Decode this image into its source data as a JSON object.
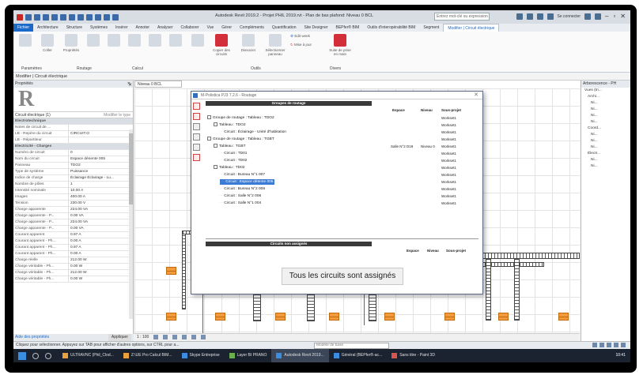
{
  "titlebar": {
    "title": "Autodesk Revit 2019.2 - Projet PHIL 2019.rvt - Plan de bas plafond: Niveau 0 BCL",
    "search_placeholder": "Entrez mot-clé ou expression",
    "signin": "Se connecter"
  },
  "tabs": [
    "Fichier",
    "Architecture",
    "Structure",
    "Systèmes",
    "Insérer",
    "Annoter",
    "Analyser",
    "Collaborer",
    "Vue",
    "Gérer",
    "Compléments",
    "Quantification",
    "Site Designer",
    "BEPfer® BIM",
    "Outils d'interopérabilité BIM",
    "Segment",
    "Modifier | Circuit électrique"
  ],
  "ribbon": {
    "buttons": [
      "Coller",
      "Propriétés",
      "Copier des circuits",
      "Dissocier",
      "Sélectionner panneau",
      "Suite de prise en main"
    ],
    "panels": [
      "Paramètres",
      "Routage",
      "Calcul",
      "Outils",
      "Divers"
    ],
    "options": [
      "Edit week",
      "Mise à jour"
    ]
  },
  "context": "Modifier | Circuit électrique",
  "properties": {
    "header": "Propriétés",
    "logo": "R",
    "type": "Circuit électrique (1)",
    "edit_type": "Modifier le type",
    "rows": [
      {
        "k": "Electrotechnique",
        "v": "",
        "grp": true
      },
      {
        "k": "Notes de circuit de ...",
        "v": ""
      },
      {
        "k": "LB - Repère du circuit",
        "v": "CIRCUIT.O"
      },
      {
        "k": "LB - Répartiteur",
        "v": ""
      },
      {
        "k": "Electricité - Charges",
        "v": "",
        "grp": true
      },
      {
        "k": "Numéro de circuit",
        "v": "0"
      },
      {
        "k": "Nom du circuit",
        "v": "Espace dénente 005"
      },
      {
        "k": "Panneau",
        "v": "TDO2"
      },
      {
        "k": "Type de système",
        "v": "Puissance"
      },
      {
        "k": "Indice de charge",
        "v": "Éclairage Éclairage - Lu..."
      },
      {
        "k": "Nombre de pôles",
        "v": "1"
      },
      {
        "k": "Intensité nominale",
        "v": "10.00 A"
      },
      {
        "k": "Images",
        "v": "400.00 A"
      },
      {
        "k": "Tension",
        "v": "230.00 V"
      },
      {
        "k": "Charge apparente",
        "v": "224.00 VA"
      },
      {
        "k": "Charge apparente - P...",
        "v": "0.00 VA"
      },
      {
        "k": "Charge apparente - P...",
        "v": "224.00 VA"
      },
      {
        "k": "Charge apparente - P...",
        "v": "0.00 VA"
      },
      {
        "k": "Courant apparent",
        "v": "0.97 A"
      },
      {
        "k": "Courant apparent - Ph...",
        "v": "0.00 A"
      },
      {
        "k": "Courant apparent - Ph...",
        "v": "0.97 A"
      },
      {
        "k": "Courant apparent - Ph...",
        "v": "0.00 A"
      },
      {
        "k": "Charge réelle",
        "v": "212.00 W"
      },
      {
        "k": "Charge véritable - Ph...",
        "v": "0.00 W"
      },
      {
        "k": "Charge véritable - Ph...",
        "v": "212.00 W"
      },
      {
        "k": "Charge véritable - Ph...",
        "v": "0.00 W"
      }
    ],
    "help": "Aide des propriétés",
    "apply": "Appliquer"
  },
  "view": {
    "tab": "Niveau 0 BCL",
    "scale": "1 : 100"
  },
  "browser": {
    "header": "Arborescence - PH",
    "items": [
      "Vues (tri...",
      "Archi...",
      "Ni...",
      "Ni...",
      "Ni...",
      "Ni...",
      "Coord...",
      "Ni...",
      "Ni...",
      "Ni...",
      "Électr...",
      "Ni...",
      "Ni..."
    ]
  },
  "dialog": {
    "title": "M-Polistica PJ3 7.2.6 - Routage",
    "groups_header": "Groupes de routage",
    "col_space": "Espace",
    "col_level": "Niveau",
    "col_subproject": "Sous-projet",
    "rows": [
      {
        "label": "Groupe de routage : Tableau : TDO2",
        "indent": 0,
        "check": true,
        "space": "",
        "level": "",
        "sub": "Workset1"
      },
      {
        "label": "Tableau : TDO2",
        "indent": 1,
        "check": true,
        "space": "",
        "level": "",
        "sub": "Workset1"
      },
      {
        "label": "Circuit : Éclairage - Unité d'habitation",
        "indent": 2,
        "check": false,
        "space": "",
        "level": "",
        "sub": "Workset1"
      },
      {
        "label": "Groupe de routage : Tableau : TGBT",
        "indent": 0,
        "check": true,
        "space": "",
        "level": "",
        "sub": "Workset1"
      },
      {
        "label": "Tableau : TGBT",
        "indent": 1,
        "check": true,
        "space": "Salle N°2 D19",
        "level": "Niveau 0",
        "sub": "Workset1"
      },
      {
        "label": "Circuit : TD01",
        "indent": 2,
        "check": false,
        "space": "",
        "level": "",
        "sub": "Workset1"
      },
      {
        "label": "Circuit : TD02",
        "indent": 2,
        "check": false,
        "space": "",
        "level": "",
        "sub": "Workset1"
      },
      {
        "label": "Tableau : TD02",
        "indent": 1,
        "check": true,
        "space": "",
        "level": "",
        "sub": "Workset1"
      },
      {
        "label": "Circuit : Bureau N°1 007",
        "indent": 2,
        "check": false,
        "space": "",
        "level": "",
        "sub": "Workset1"
      },
      {
        "label": "Circuit : Espace détente 005",
        "indent": 2,
        "check": false,
        "space": "",
        "level": "",
        "sub": "Workset1",
        "selected": true
      },
      {
        "label": "Circuit : Bureau N°2 008",
        "indent": 2,
        "check": false,
        "space": "",
        "level": "",
        "sub": "Workset1"
      },
      {
        "label": "Circuit : Salle N°2 006",
        "indent": 2,
        "check": false,
        "space": "",
        "level": "",
        "sub": "Workset1"
      },
      {
        "label": "Circuit : Salle N°1 004",
        "indent": 2,
        "check": false,
        "space": "",
        "level": "",
        "sub": "Workset1"
      }
    ],
    "unassigned_header": "Circuits non assignés",
    "all_assigned": "Tous les circuits sont assignés"
  },
  "statusbar": {
    "text": "Cliquez pour sélectionner. Appuyez sur TAB pour afficher d'autres options, sur CTRL pour a...",
    "model": "Modèle de base"
  },
  "taskbar": {
    "tasks": [
      {
        "label": "ULTRAVNC (Phil_Clod...",
        "color": "y"
      },
      {
        "label": "Z:\\UE Pro Calcul BIM...",
        "color": "y"
      },
      {
        "label": "Skype Entreprise",
        "color": "b"
      },
      {
        "label": "Layer BI PRANO",
        "color": "g"
      },
      {
        "label": "Autodesk Revit 2019...",
        "color": "b",
        "active": true
      },
      {
        "label": "Général (BEPfer®-ac...",
        "color": "b"
      },
      {
        "label": "Sans titre - Paint 3D",
        "color": "r"
      }
    ],
    "time": "10:41",
    "date": ""
  }
}
